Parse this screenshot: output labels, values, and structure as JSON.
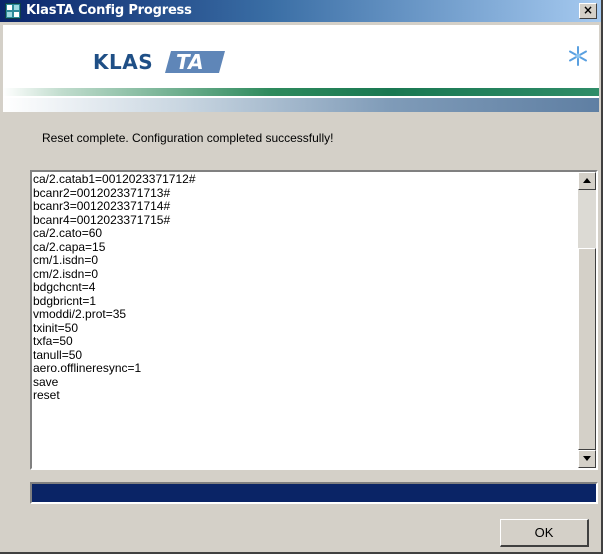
{
  "window": {
    "title": "KlasTA Config Progress",
    "close_label": "×"
  },
  "banner": {
    "logo_text": "KLAS",
    "logo_mark_text": "TA",
    "snow_icon": "snowflake-icon"
  },
  "status_text": "Reset complete. Configuration completed successfully!",
  "log_lines": [
    "ca/2.catab1=0012023371712#",
    "bcanr2=0012023371713#",
    "bcanr3=0012023371714#",
    "bcanr4=0012023371715#",
    "ca/2.cato=60",
    "ca/2.capa=15",
    "cm/1.isdn=0",
    "cm/2.isdn=0",
    "bdgchcnt=4",
    "bdgbricnt=1",
    "vmoddi/2.prot=35",
    "txinit=50",
    "txfa=50",
    "tanull=50",
    "aero.offlineresync=1",
    "save",
    "reset"
  ],
  "progress": {
    "fraction": 1.0
  },
  "buttons": {
    "ok_label": "OK"
  },
  "colors": {
    "title_bar": "#0a246a",
    "progress_fill": "#0a2466",
    "face": "#d4d0c8",
    "logo_blue": "#1f4f86"
  }
}
